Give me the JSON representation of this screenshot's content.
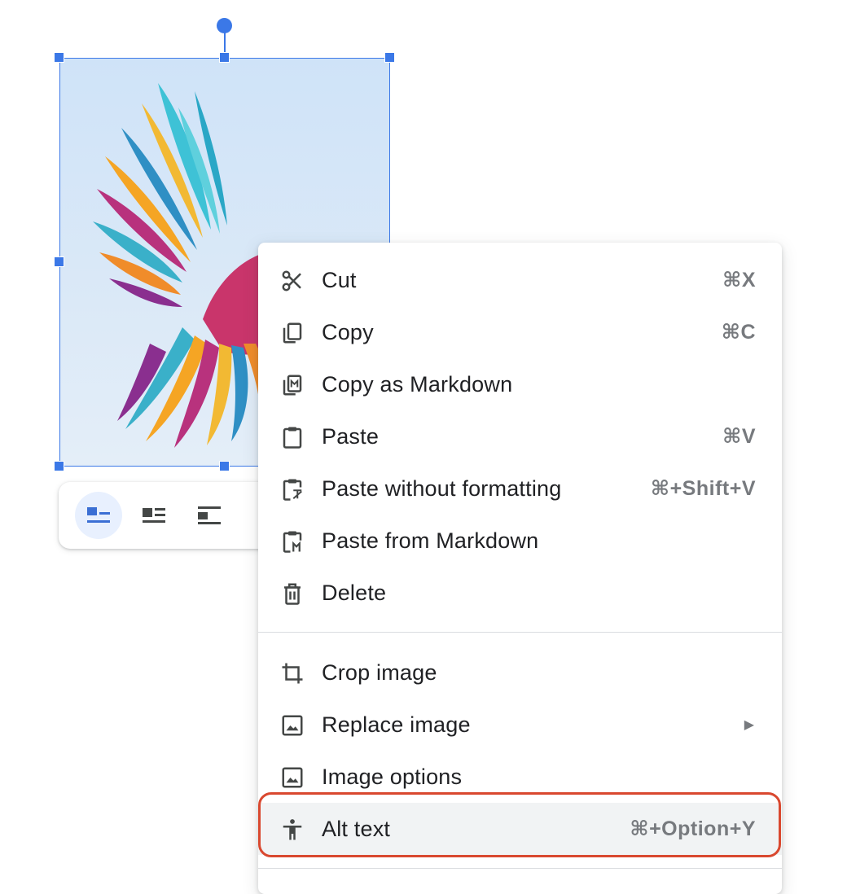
{
  "context_menu": {
    "items": [
      {
        "label": "Cut",
        "shortcut": "⌘X",
        "icon": "scissors-icon"
      },
      {
        "label": "Copy",
        "shortcut": "⌘C",
        "icon": "copy-icon"
      },
      {
        "label": "Copy as Markdown",
        "shortcut": "",
        "icon": "copy-markdown-icon"
      },
      {
        "label": "Paste",
        "shortcut": "⌘V",
        "icon": "clipboard-icon"
      },
      {
        "label": "Paste without formatting",
        "shortcut": "⌘+Shift+V",
        "icon": "paste-no-format-icon"
      },
      {
        "label": "Paste from Markdown",
        "shortcut": "",
        "icon": "paste-markdown-icon"
      },
      {
        "label": "Delete",
        "shortcut": "",
        "icon": "trash-icon"
      },
      {
        "label": "Crop image",
        "shortcut": "",
        "icon": "crop-icon"
      },
      {
        "label": "Replace image",
        "submenu_arrow": "▶",
        "icon": "image-icon"
      },
      {
        "label": "Image options",
        "shortcut": "",
        "icon": "image-icon"
      },
      {
        "label": "Alt text",
        "shortcut": "⌘+Option+Y",
        "icon": "accessibility-icon"
      }
    ],
    "highlighted_item": "Alt text"
  },
  "image_toolbar": {
    "buttons": [
      {
        "icon": "wrap-inline-icon",
        "active": true
      },
      {
        "icon": "wrap-text-icon",
        "active": false
      },
      {
        "icon": "break-text-icon",
        "active": false
      }
    ]
  },
  "colors": {
    "selection": "#3b78e7",
    "annotation": "#d9482f",
    "highlight_bg": "#f1f3f4",
    "toolbar_active_bg": "#e8f0fe"
  }
}
